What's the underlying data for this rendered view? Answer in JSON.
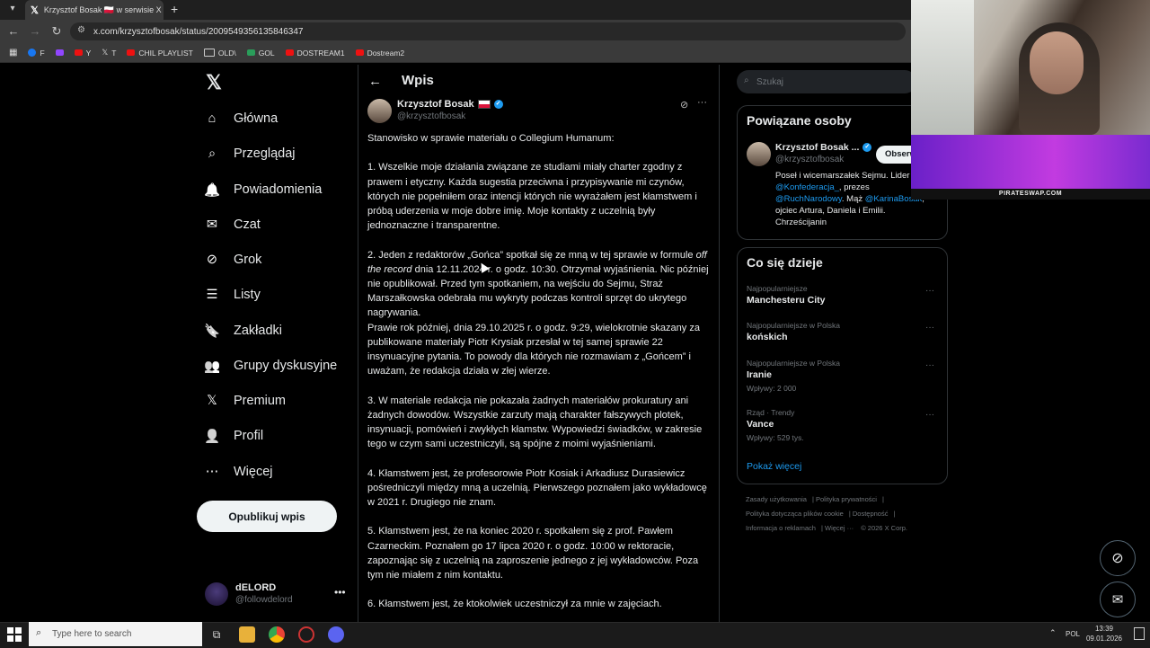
{
  "browser": {
    "tab_title": "Krzysztof Bosak 🇵🇱 w serwisie X",
    "url": "x.com/krzysztofbosak/status/2009549356135846347",
    "bookmarks": [
      "F",
      "Y",
      "T",
      "CHIL PLAYLIST",
      "OLD\\",
      "GOL",
      "DOSTREAM1",
      "Dostream2"
    ]
  },
  "nav": {
    "items": [
      {
        "label": "Główna",
        "icon": "home-icon"
      },
      {
        "label": "Przeglądaj",
        "icon": "search-icon"
      },
      {
        "label": "Powiadomienia",
        "icon": "bell-icon"
      },
      {
        "label": "Czat",
        "icon": "mail-icon"
      },
      {
        "label": "Grok",
        "icon": "grok-icon"
      },
      {
        "label": "Listy",
        "icon": "list-icon"
      },
      {
        "label": "Zakładki",
        "icon": "bookmark-icon"
      },
      {
        "label": "Grupy dyskusyjne",
        "icon": "people-icon"
      },
      {
        "label": "Premium",
        "icon": "x-icon"
      },
      {
        "label": "Profil",
        "icon": "person-icon"
      },
      {
        "label": "Więcej",
        "icon": "more-circle-icon"
      }
    ],
    "post_button": "Opublikuj wpis",
    "account": {
      "name": "dELORD",
      "handle": "@followdelord"
    }
  },
  "post": {
    "header": "Wpis",
    "author_name": "Krzysztof Bosak",
    "author_handle": "@krzysztofbosak",
    "paragraphs": [
      "Stanowisko w sprawie materiału o Collegium Humanum:",
      "1. Wszelkie moje działania związane ze studiami miały charter zgodny z prawem i etyczny. Każda sugestia przeciwna i przypisywanie mi czynów, których nie popełniłem oraz intencji których nie wyrażałem jest kłamstwem i próbą uderzenia w moje dobre imię. Moje kontakty z uczelnią były jednoznaczne i transparentne.",
      "2. Jeden z redaktorów „Gońca” spotkał się ze mną w tej sprawie w formule",
      "off the record",
      "dnia 12.11.2024 r. o godz. 10:30. Otrzymał wyjaśnienia. Nic później nie opublikował. Przed tym spotkaniem, na wejściu do Sejmu, Straż Marszałkowska odebrała mu wykryty podczas kontroli sprzęt do ukrytego nagrywania.",
      "Prawie rok później, dnia 29.10.2025 r. o godz. 9:29, wielokrotnie skazany za publikowane materiały Piotr Krysiak przesłał w tej samej sprawie 22 insynuacyjne pytania. To powody dla których nie rozmawiam z „Gońcem” i uważam, że redakcja działa w złej wierze.",
      "3. W materiale redakcja nie pokazała żadnych materiałów prokuratury ani żadnych dowodów. Wszystkie zarzuty mają charakter fałszywych plotek, insynuacji, pomówień i zwykłych kłamstw. Wypowiedzi świadków, w zakresie tego w czym sami uczestniczyli, są spójne z moimi wyjaśnieniami.",
      "4. Kłamstwem jest, że profesorowie Piotr Kosiak i Arkadiusz Durasiewicz pośredniczyli między mną a uczelnią. Pierwszego poznałem jako wykładowcę w 2021 r. Drugiego nie znam.",
      "5. Kłamstwem jest, że na koniec 2020 r. spotkałem się z prof. Pawłem Czarneckim. Poznałem go 17 lipca 2020 r. o godz. 10:00 w rektoracie, zapoznając się z uczelnią na zaproszenie jednego z jej wykładowców. Poza tym nie miałem z nim kontaktu.",
      "6. Kłamstwem jest, że ktokolwiek uczestniczył za mnie w zajęciach."
    ]
  },
  "sidebar": {
    "search_placeholder": "Szukaj",
    "related": {
      "title": "Powiązane osoby",
      "name": "Krzysztof Bosak ...",
      "handle": "@krzysztofbosak",
      "follow": "Obserwuj",
      "bio_1": "Poseł i wicemarszałek Sejmu. Lider",
      "bio_2": "@Konfederacja_",
      "bio_3": ", prezes",
      "bio_4": "@RuchNarodowy",
      "bio_5": ". Mąż",
      "bio_6": "@KarinaBosak",
      "bio_7": ", ojciec Artura, Daniela i Emilii. Chrześcijanin"
    },
    "trends": {
      "title": "Co się dzieje",
      "items": [
        {
          "meta": "Najpopularniejsze",
          "name": "Manchesteru City",
          "posts": ""
        },
        {
          "meta": "Najpopularniejsze w Polska",
          "name": "końskich",
          "posts": ""
        },
        {
          "meta": "Najpopularniejsze w Polska",
          "name": "Iranie",
          "posts": "Wpływy: 2 000"
        },
        {
          "meta": "Rząd · Trendy",
          "name": "Vance",
          "posts": "Wpływy: 529 tys."
        }
      ],
      "show_more": "Pokaż więcej"
    },
    "footer": [
      "Zasady użytkowania",
      "Polityka prywatności",
      "Polityka dotycząca plików cookie",
      "Dostępność",
      "Informacja o reklamach",
      "Więcej ···",
      "© 2026 X Corp."
    ]
  },
  "overlay": {
    "banner_text": "PIRATESWAP.COM"
  },
  "taskbar": {
    "search_placeholder": "Type here to search",
    "lang": "POL",
    "time": "13:39",
    "date": "09.01.2026"
  }
}
